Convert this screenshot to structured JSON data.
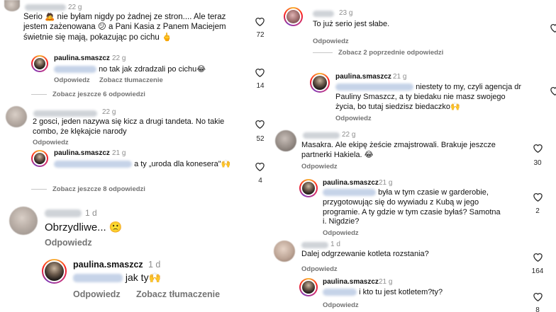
{
  "left_top": {
    "comment1": {
      "time": "22 g",
      "text": [
        "Serio 🙇 nie byłam nigdy po żadnej ze stron.... Ale teraz",
        "jestem zażenowana 😕 a Pani Kasia z Panem Maciejem",
        "świetnie się mają, pokazując po cichu 🖕"
      ],
      "likes": "72"
    },
    "reply1": {
      "username": "paulina.smaszcz",
      "time": "22 g",
      "text": "no tak jak zdradzali po cichu😂",
      "likes": "14",
      "reply_btn": "Odpowiedz",
      "translate_btn": "Zobacz tłumaczenie"
    },
    "more1": "Zobacz jeszcze 6 odpowiedzi",
    "comment2": {
      "time": "22 g",
      "text": [
        "2 gosci, jeden nazywa się kicz a drugi tandeta. No takie",
        "combo, że klękajcie narody"
      ],
      "likes": "52",
      "reply_btn": "Odpowiedz"
    },
    "reply2": {
      "username": "paulina.smaszcz",
      "time": "21 g",
      "text": "a ty „uroda dla konesera\"🙌",
      "likes": "4"
    },
    "more2": "Zobacz jeszcze 8 odpowiedzi"
  },
  "left_bottom": {
    "comment": {
      "time": "1 d",
      "text": "Obrzydliwe... 🙁",
      "reply_btn": "Odpowiedz"
    },
    "reply": {
      "username": "paulina.smaszcz",
      "time": "1 d",
      "text": "jak ty🙌",
      "reply_btn": "Odpowiedz",
      "translate_btn": "Zobacz tłumaczenie"
    }
  },
  "right_top": {
    "comment": {
      "time": "23 g",
      "text": "To już serio jest słabe.",
      "reply_btn": "Odpowiedz"
    },
    "prev": "Zobacz 2 poprzednie odpowiedzi",
    "reply": {
      "username": "paulina.smaszcz",
      "time": "21 g",
      "text": [
        "niestety to my, czyli agencja dr",
        "Pauliny Smaszcz, a ty biedaku nie masz swojego",
        "życia, bo tutaj siedzisz biedaczko🙌"
      ],
      "reply_btn": "Odpowiedz"
    }
  },
  "right_bottom": {
    "comment1": {
      "time": "22 g",
      "text": [
        "Masakra. Ale ekipę żeście zmajstrowali. Brakuje jeszcze",
        "partnerki Hakiela. 😂"
      ],
      "likes": "30",
      "reply_btn": "Odpowiedz"
    },
    "reply1": {
      "username": "paulina.smaszcz",
      "time": "21 g",
      "text": [
        "była w tym czasie w garderobie,",
        "przygotowując się do wywiadu z Kubą w jego",
        "programie. A ty gdzie w tym czasie byłaś? Samotna",
        "i. Nigdzie?"
      ],
      "likes": "2",
      "reply_btn": "Odpowiedz"
    },
    "comment2": {
      "time": "1 d",
      "text": "Dalej odgrzewanie kotleta rozstania?",
      "likes": "164",
      "reply_btn": "Odpowiedz"
    },
    "reply2": {
      "username": "paulina.smaszcz",
      "time": "21 g",
      "text": "i kto tu jest kotletem?ty?",
      "likes": "8",
      "reply_btn": "Odpowiedz"
    }
  },
  "colors": {
    "muted": "#737373",
    "divider": "#e6e6e6",
    "heart": "#262626"
  },
  "icons": [
    "heart-icon",
    "avatar"
  ]
}
